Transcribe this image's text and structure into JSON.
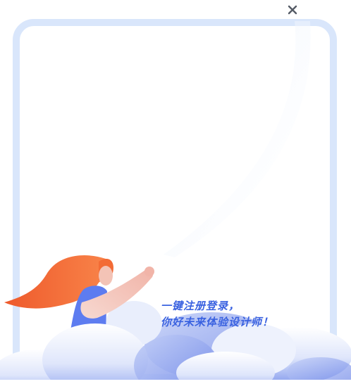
{
  "dialog": {
    "close_icon": "close-icon",
    "close_glyph": "✕",
    "frame_color": "#d9e6fb",
    "accent_color": "#3a62e0"
  },
  "promo": {
    "line1": "一键注册登录，",
    "line2": "你好未来体验设计师！"
  }
}
